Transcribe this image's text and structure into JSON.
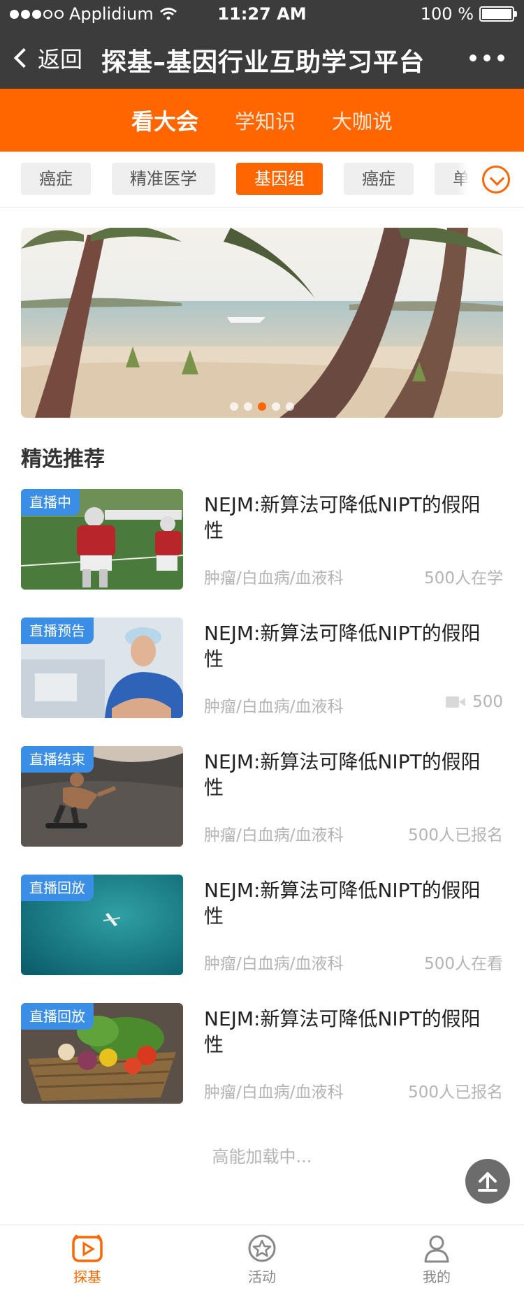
{
  "status_bar": {
    "carrier": "Applidium",
    "time": "11:27 AM",
    "battery_text": "100 %",
    "battery_level": 1.0
  },
  "nav": {
    "back_label": "返回",
    "title": "探基–基因行业互助学习平台"
  },
  "tabs": [
    {
      "label": "看大会",
      "active": true
    },
    {
      "label": "学知识",
      "active": false
    },
    {
      "label": "大咖说",
      "active": false
    }
  ],
  "categories": [
    {
      "label": "癌症",
      "active": false
    },
    {
      "label": "精准医学",
      "active": false
    },
    {
      "label": "基因组",
      "active": true
    },
    {
      "label": "癌症",
      "active": false
    },
    {
      "label": "单细胞",
      "active": false
    }
  ],
  "banner": {
    "page_count": 5,
    "active_page": 3,
    "accent_color": "#ff6600"
  },
  "section_title": "精选推荐",
  "items": [
    {
      "badge": "直播中",
      "title": "NEJM:新算法可降低NIPT的假阳性",
      "tags": "肿瘤/白血病/血液科",
      "stat": "500人在学",
      "stat_icon": ""
    },
    {
      "badge": "直播预告",
      "title": "NEJM:新算法可降低NIPT的假阳性",
      "tags": "肿瘤/白血病/血液科",
      "stat": "500",
      "stat_icon": "video-camera-icon"
    },
    {
      "badge": "直播结束",
      "title": "NEJM:新算法可降低NIPT的假阳性",
      "tags": "肿瘤/白血病/血液科",
      "stat": "500人已报名",
      "stat_icon": ""
    },
    {
      "badge": "直播回放",
      "title": "NEJM:新算法可降低NIPT的假阳性",
      "tags": "肿瘤/白血病/血液科",
      "stat": "500人在看",
      "stat_icon": ""
    },
    {
      "badge": "直播回放",
      "title": "NEJM:新算法可降低NIPT的假阳性",
      "tags": "肿瘤/白血病/血液科",
      "stat": "500人已报名",
      "stat_icon": ""
    }
  ],
  "loading_text": "高能加载中...",
  "bottom_tabs": [
    {
      "label": "探基",
      "icon": "play-icon",
      "active": true
    },
    {
      "label": "活动",
      "icon": "star-icon",
      "active": false
    },
    {
      "label": "我的",
      "icon": "user-icon",
      "active": false
    }
  ],
  "colors": {
    "brand": "#ff6600",
    "nav_background": "#3c3c3c",
    "badge": "#3a8ee6"
  }
}
